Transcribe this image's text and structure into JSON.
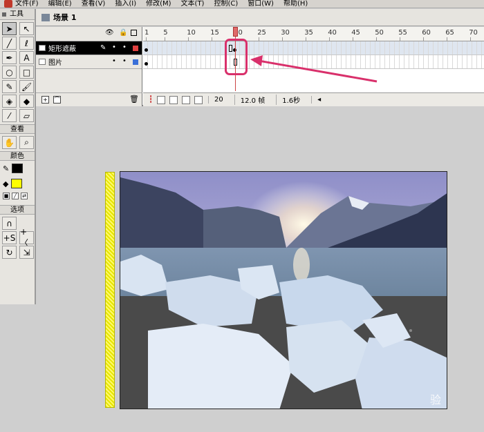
{
  "menubar": {
    "items": [
      "文件(F)",
      "编辑(E)",
      "查看(V)",
      "插入(I)",
      "修改(M)",
      "文本(T)",
      "控制(C)",
      "窗口(W)",
      "帮助(H)"
    ]
  },
  "toolbox": {
    "title": "工具",
    "sections": {
      "view": "查看",
      "colors": "颜色",
      "options": "选项"
    },
    "stroke_color": "#000000",
    "fill_color": "#ffff00"
  },
  "scene": {
    "label": "场景 1"
  },
  "timeline": {
    "ruler_labels": [
      "1",
      "5",
      "10",
      "15",
      "20",
      "25",
      "30",
      "35",
      "40",
      "45",
      "50",
      "55",
      "60",
      "65",
      "70"
    ],
    "layers": [
      {
        "name": "矩形遮蔽",
        "selected": true,
        "color": "#e04040"
      },
      {
        "name": "图片",
        "selected": false,
        "color": "#3a6fd8"
      }
    ],
    "current_frame": "20",
    "frame_rate": "12.0 帧",
    "elapsed": "1.6秒"
  },
  "stage": {
    "watermark": "验"
  },
  "colors": {
    "highlight": "#d9306b",
    "mask": "#e6e600"
  }
}
